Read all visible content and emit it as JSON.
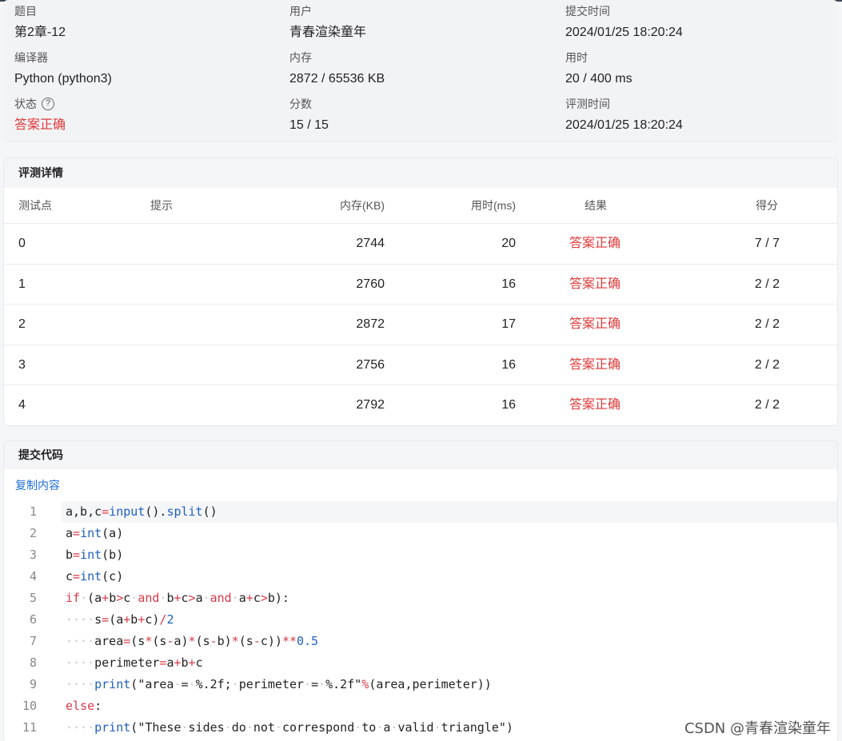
{
  "info": {
    "problem": {
      "label": "题目",
      "value": "第2章-12"
    },
    "user": {
      "label": "用户",
      "value": "青春渲染童年"
    },
    "submit_time": {
      "label": "提交时间",
      "value": "2024/01/25 18:20:24"
    },
    "compiler": {
      "label": "编译器",
      "value": "Python (python3)"
    },
    "memory": {
      "label": "内存",
      "value": "2872 / 65536 KB"
    },
    "time_used": {
      "label": "用时",
      "value": "20 / 400 ms"
    },
    "status": {
      "label": "状态",
      "help_icon": "?",
      "value": "答案正确"
    },
    "score": {
      "label": "分数",
      "value": "15 / 15"
    },
    "judge_time": {
      "label": "评测时间",
      "value": "2024/01/25 18:20:24"
    }
  },
  "details": {
    "title": "评测详情",
    "columns": [
      "测试点",
      "提示",
      "内存(KB)",
      "用时(ms)",
      "结果",
      "得分"
    ],
    "rows": [
      {
        "case": "0",
        "hint": "",
        "memory": "2744",
        "time": "20",
        "result": "答案正确",
        "score": "7 / 7"
      },
      {
        "case": "1",
        "hint": "",
        "memory": "2760",
        "time": "16",
        "result": "答案正确",
        "score": "2 / 2"
      },
      {
        "case": "2",
        "hint": "",
        "memory": "2872",
        "time": "17",
        "result": "答案正确",
        "score": "2 / 2"
      },
      {
        "case": "3",
        "hint": "",
        "memory": "2756",
        "time": "16",
        "result": "答案正确",
        "score": "2 / 2"
      },
      {
        "case": "4",
        "hint": "",
        "memory": "2792",
        "time": "16",
        "result": "答案正确",
        "score": "2 / 2"
      }
    ]
  },
  "code": {
    "title": "提交代码",
    "copy_label": "复制内容",
    "lines": [
      {
        "no": "1",
        "text": "a,b,c=input().split()"
      },
      {
        "no": "2",
        "text": "a=int(a)"
      },
      {
        "no": "3",
        "text": "b=int(b)"
      },
      {
        "no": "4",
        "text": "c=int(c)"
      },
      {
        "no": "5",
        "text": "if (a+b>c and b+c>a and a+c>b):"
      },
      {
        "no": "6",
        "text": "    s=(a+b+c)/2"
      },
      {
        "no": "7",
        "text": "    area=(s*(s-a)*(s-b)*(s-c))**0.5"
      },
      {
        "no": "8",
        "text": "    perimeter=a+b+c"
      },
      {
        "no": "9",
        "text": "    print(\"area = %.2f; perimeter = %.2f\"%(area,perimeter))"
      },
      {
        "no": "10",
        "text": "else:"
      },
      {
        "no": "11",
        "text": "    print(\"These sides do not correspond to a valid triangle\")"
      }
    ]
  },
  "watermark": "CSDN @青春渲染童年",
  "colors": {
    "accepted": "#e03a3a",
    "link": "#1f6fd6",
    "keyword": "#d73a49",
    "function": "#1f5fbf"
  }
}
